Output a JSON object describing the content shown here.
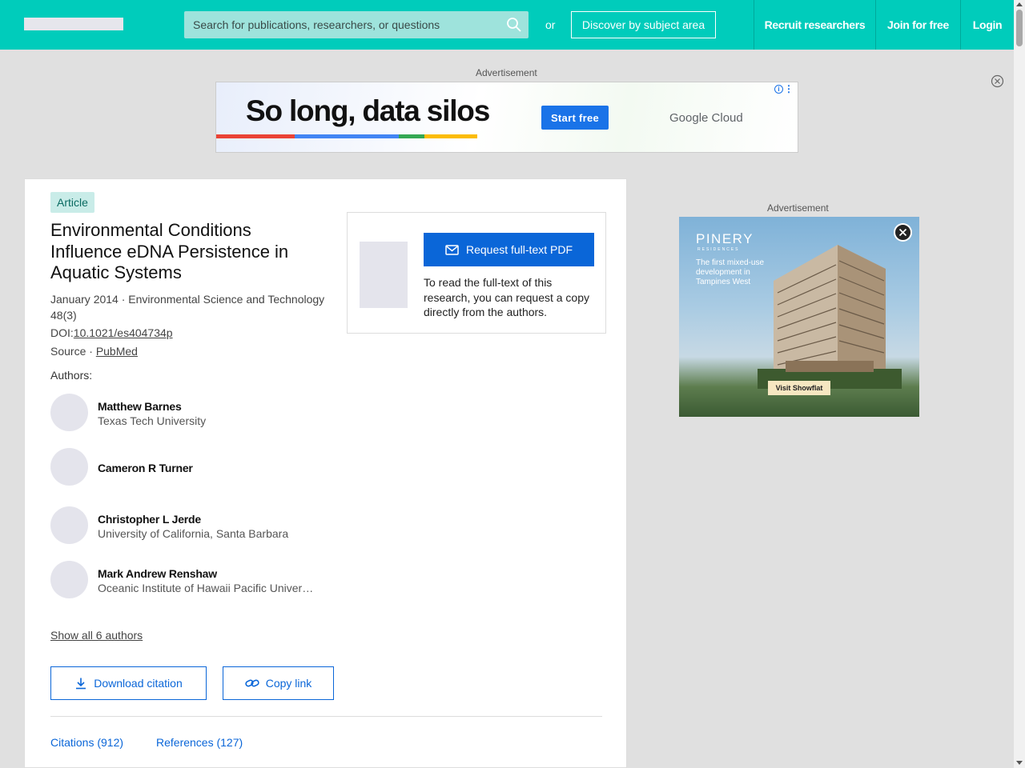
{
  "nav": {
    "search_placeholder": "Search for publications, researchers, or questions",
    "or_text": "or",
    "discover_label": "Discover by subject area",
    "recruit_label": "Recruit researchers",
    "join_label": "Join for free",
    "login_label": "Login"
  },
  "ads": {
    "label": "Advertisement",
    "top": {
      "headline": "So long, data silos",
      "cta": "Start free",
      "brand": "Google Cloud"
    },
    "side": {
      "brand": "PINERY",
      "sub": "RESIDENCES",
      "text": "The first mixed-use development in Tampines West",
      "cta": "Visit Showflat"
    }
  },
  "article": {
    "badge": "Article",
    "title": "Environmental Conditions Influence eDNA Persistence in Aquatic Systems",
    "date_journal": "January 2014 · Environmental Science and Technology 48(3)",
    "doi_prefix": "DOI:",
    "doi": "10.1021/es404734p",
    "source_prefix": "Source · ",
    "source": "PubMed",
    "authors_label": "Authors:",
    "authors": [
      {
        "name": "Matthew Barnes",
        "institution": "Texas Tech University"
      },
      {
        "name": "Cameron R Turner",
        "institution": ""
      },
      {
        "name": "Christopher L Jerde",
        "institution": "University of California, Santa Barbara"
      },
      {
        "name": "Mark Andrew Renshaw",
        "institution": "Oceanic Institute of Hawaii Pacific University"
      }
    ],
    "show_all": "Show all 6 authors",
    "download_citation": "Download citation",
    "copy_link": "Copy link",
    "tabs": [
      "Citations (912)",
      "References (127)"
    ]
  },
  "request": {
    "button": "Request full-text PDF",
    "text": "To read the full-text of this research, you can request a copy directly from the authors."
  }
}
